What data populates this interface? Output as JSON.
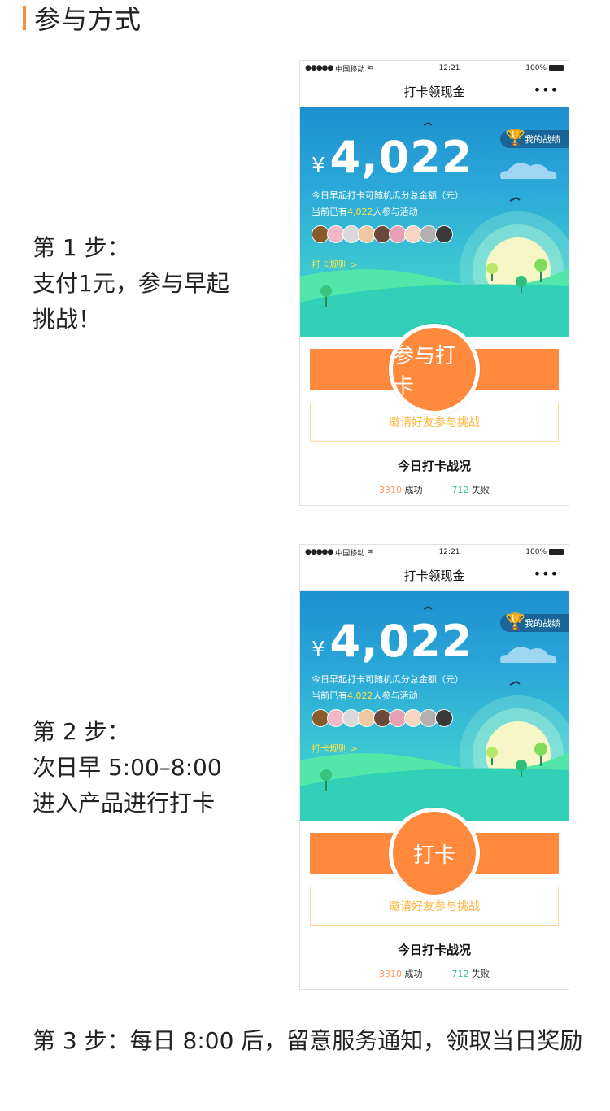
{
  "section_title": "参与方式",
  "steps": [
    {
      "line1": "第 1 步：",
      "line2": "支付1元，参与早起",
      "line3": "挑战！"
    },
    {
      "line1": "第 2 步：",
      "line2": "次日早 5:00–8:00",
      "line3": "进入产品进行打卡"
    },
    {
      "text": "第 3 步：每日 8:00 后，留意服务通知，领取当日奖励"
    }
  ],
  "phone": {
    "status_carrier": "中国移动",
    "status_time": "12:21",
    "status_battery": "100%",
    "nav_title": "打卡领现金",
    "nav_more": "•••",
    "badge_label": "我的战绩",
    "currency": "¥",
    "amount": "4,022",
    "desc_line1": "今日早起打卡可随机瓜分总金额（元）",
    "desc_prefix": "当前已有",
    "participants": "4,022",
    "desc_suffix": "人参与活动",
    "rules_link": "打卡规则 >",
    "invite_label": "邀请好友参与挑战",
    "today_title": "今日打卡战况",
    "success_count": "3310",
    "success_label": "成功",
    "fail_count": "712",
    "fail_label": "失败",
    "avatar_colors": [
      "#8b5a2b",
      "#f2b8c6",
      "#d9d9d9",
      "#f0c8a0",
      "#6b4a3a",
      "#e8a0b4",
      "#f5d6c0",
      "#b0b0b0",
      "#3a3a3a"
    ]
  },
  "screens": [
    {
      "button_label": "参与打卡"
    },
    {
      "button_label": "打卡"
    }
  ]
}
